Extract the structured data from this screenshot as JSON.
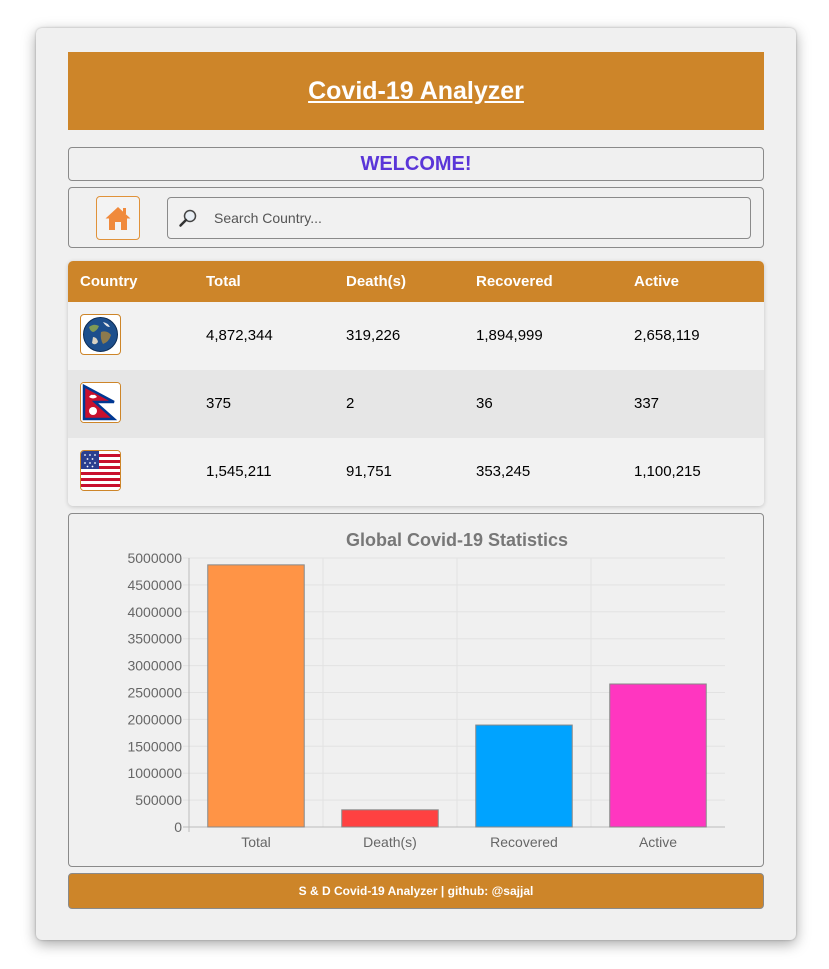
{
  "header": {
    "title": "Covid-19 Analyzer"
  },
  "welcome": {
    "text": "WELCOME!"
  },
  "toolbar": {
    "home_icon": "home-icon",
    "search_icon": "magnifier-icon",
    "search_placeholder": "Search Country..."
  },
  "table": {
    "columns": [
      "Country",
      "Total",
      "Death(s)",
      "Recovered",
      "Active"
    ],
    "rows": [
      {
        "flag": "globe-icon",
        "total": "4,872,344",
        "deaths": "319,226",
        "recovered": "1,894,999",
        "active": "2,658,119"
      },
      {
        "flag": "nepal-flag-icon",
        "total": "375",
        "deaths": "2",
        "recovered": "36",
        "active": "337"
      },
      {
        "flag": "usa-flag-icon",
        "total": "1,545,211",
        "deaths": "91,751",
        "recovered": "353,245",
        "active": "1,100,215"
      }
    ]
  },
  "chart_data": {
    "type": "bar",
    "title": "Global Covid-19 Statistics",
    "categories": [
      "Total",
      "Death(s)",
      "Recovered",
      "Active"
    ],
    "values": [
      4872344,
      319226,
      1894999,
      2658119
    ],
    "colors": [
      "#ff9446",
      "#ff4141",
      "#00a3ff",
      "#ff36c0"
    ],
    "ylim": [
      0,
      5000000
    ],
    "yticks": [
      0,
      500000,
      1000000,
      1500000,
      2000000,
      2500000,
      3000000,
      3500000,
      4000000,
      4500000,
      5000000
    ],
    "grid": true,
    "legend": "none"
  },
  "footer": {
    "text": "S & D Covid-19 Analyzer | github: @sajjal"
  },
  "colors": {
    "accent": "#cd8529",
    "welcome": "#5a36d8",
    "home_icon": "#f08a3c"
  }
}
